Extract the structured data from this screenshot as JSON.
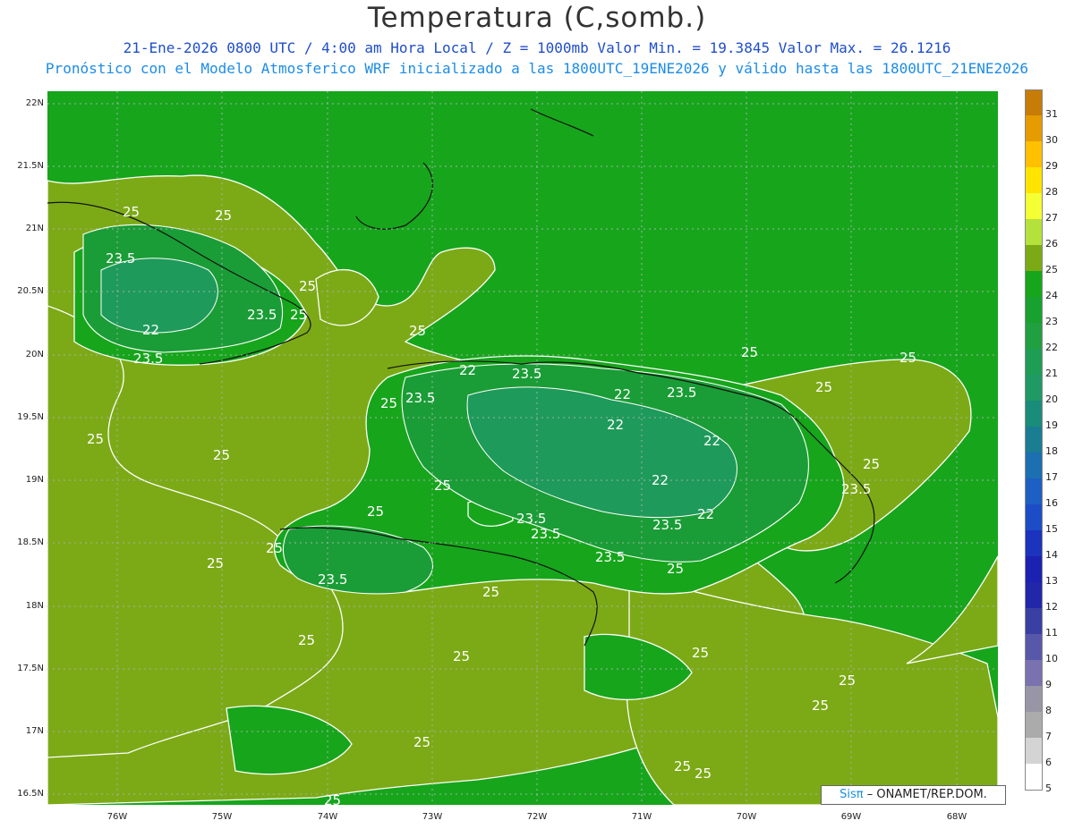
{
  "header": {
    "title": "Temperatura (C,somb.)",
    "subtitle_1": "21-Ene-2026 0800 UTC / 4:00 am Hora Local / Z = 1000mb   Valor Min. = 19.3845  Valor Max. = 26.1216",
    "subtitle_2": "Pronóstico con el Modelo Atmosferico WRF inicializado a las 1800UTC_19ENE2026 y válido hasta las  1800UTC_21ENE2026"
  },
  "axes": {
    "y_labels": [
      "22N",
      "21.5N",
      "21N",
      "20.5N",
      "20N",
      "19.5N",
      "19N",
      "18.5N",
      "18N",
      "17.5N",
      "17N",
      "16.5N"
    ],
    "x_labels": [
      "76W",
      "75W",
      "74W",
      "73W",
      "72W",
      "71W",
      "70W",
      "69W",
      "68W"
    ]
  },
  "colorbar": {
    "levels": [
      "31",
      "30",
      "29",
      "28",
      "27",
      "26",
      "25",
      "24",
      "23",
      "22",
      "21",
      "20",
      "19",
      "18",
      "17",
      "16",
      "15",
      "14",
      "13",
      "12",
      "11",
      "10",
      "9",
      "8",
      "7",
      "6",
      "5"
    ],
    "colors": [
      "#c67c06",
      "#e69b00",
      "#ffc000",
      "#ffe400",
      "#f4ff34",
      "#b5e13c",
      "#7caa16",
      "#17a51c",
      "#18a12e",
      "#20a040",
      "#1e9d54",
      "#1f9a64",
      "#1a8c7a",
      "#1a7d92",
      "#1c6fb0",
      "#1d5fc3",
      "#1d4dc6",
      "#1b33bd",
      "#1b21b0",
      "#2226a8",
      "#3a3fa4",
      "#5858aa",
      "#7a72ae",
      "#9896a6",
      "#ababab",
      "#d4d4d4",
      "#ffffff"
    ]
  },
  "contour_labels": [
    "25",
    "25",
    "23.5",
    "25",
    "25",
    "23.5",
    "22",
    "23.5",
    "25",
    "25",
    "25",
    "22",
    "23.5",
    "23.5",
    "25",
    "22",
    "23.5",
    "25",
    "25",
    "22",
    "25",
    "22",
    "23.5",
    "25",
    "25",
    "22",
    "22",
    "23.5",
    "23.5",
    "23.5",
    "25",
    "25",
    "23.5",
    "25",
    "23.5",
    "25",
    "25",
    "25",
    "25",
    "25",
    "25",
    "25",
    "25",
    "25",
    "25",
    "25"
  ],
  "credit": {
    "logo": "Sisπ",
    "org": "– ONAMET/REP.DOM."
  }
}
